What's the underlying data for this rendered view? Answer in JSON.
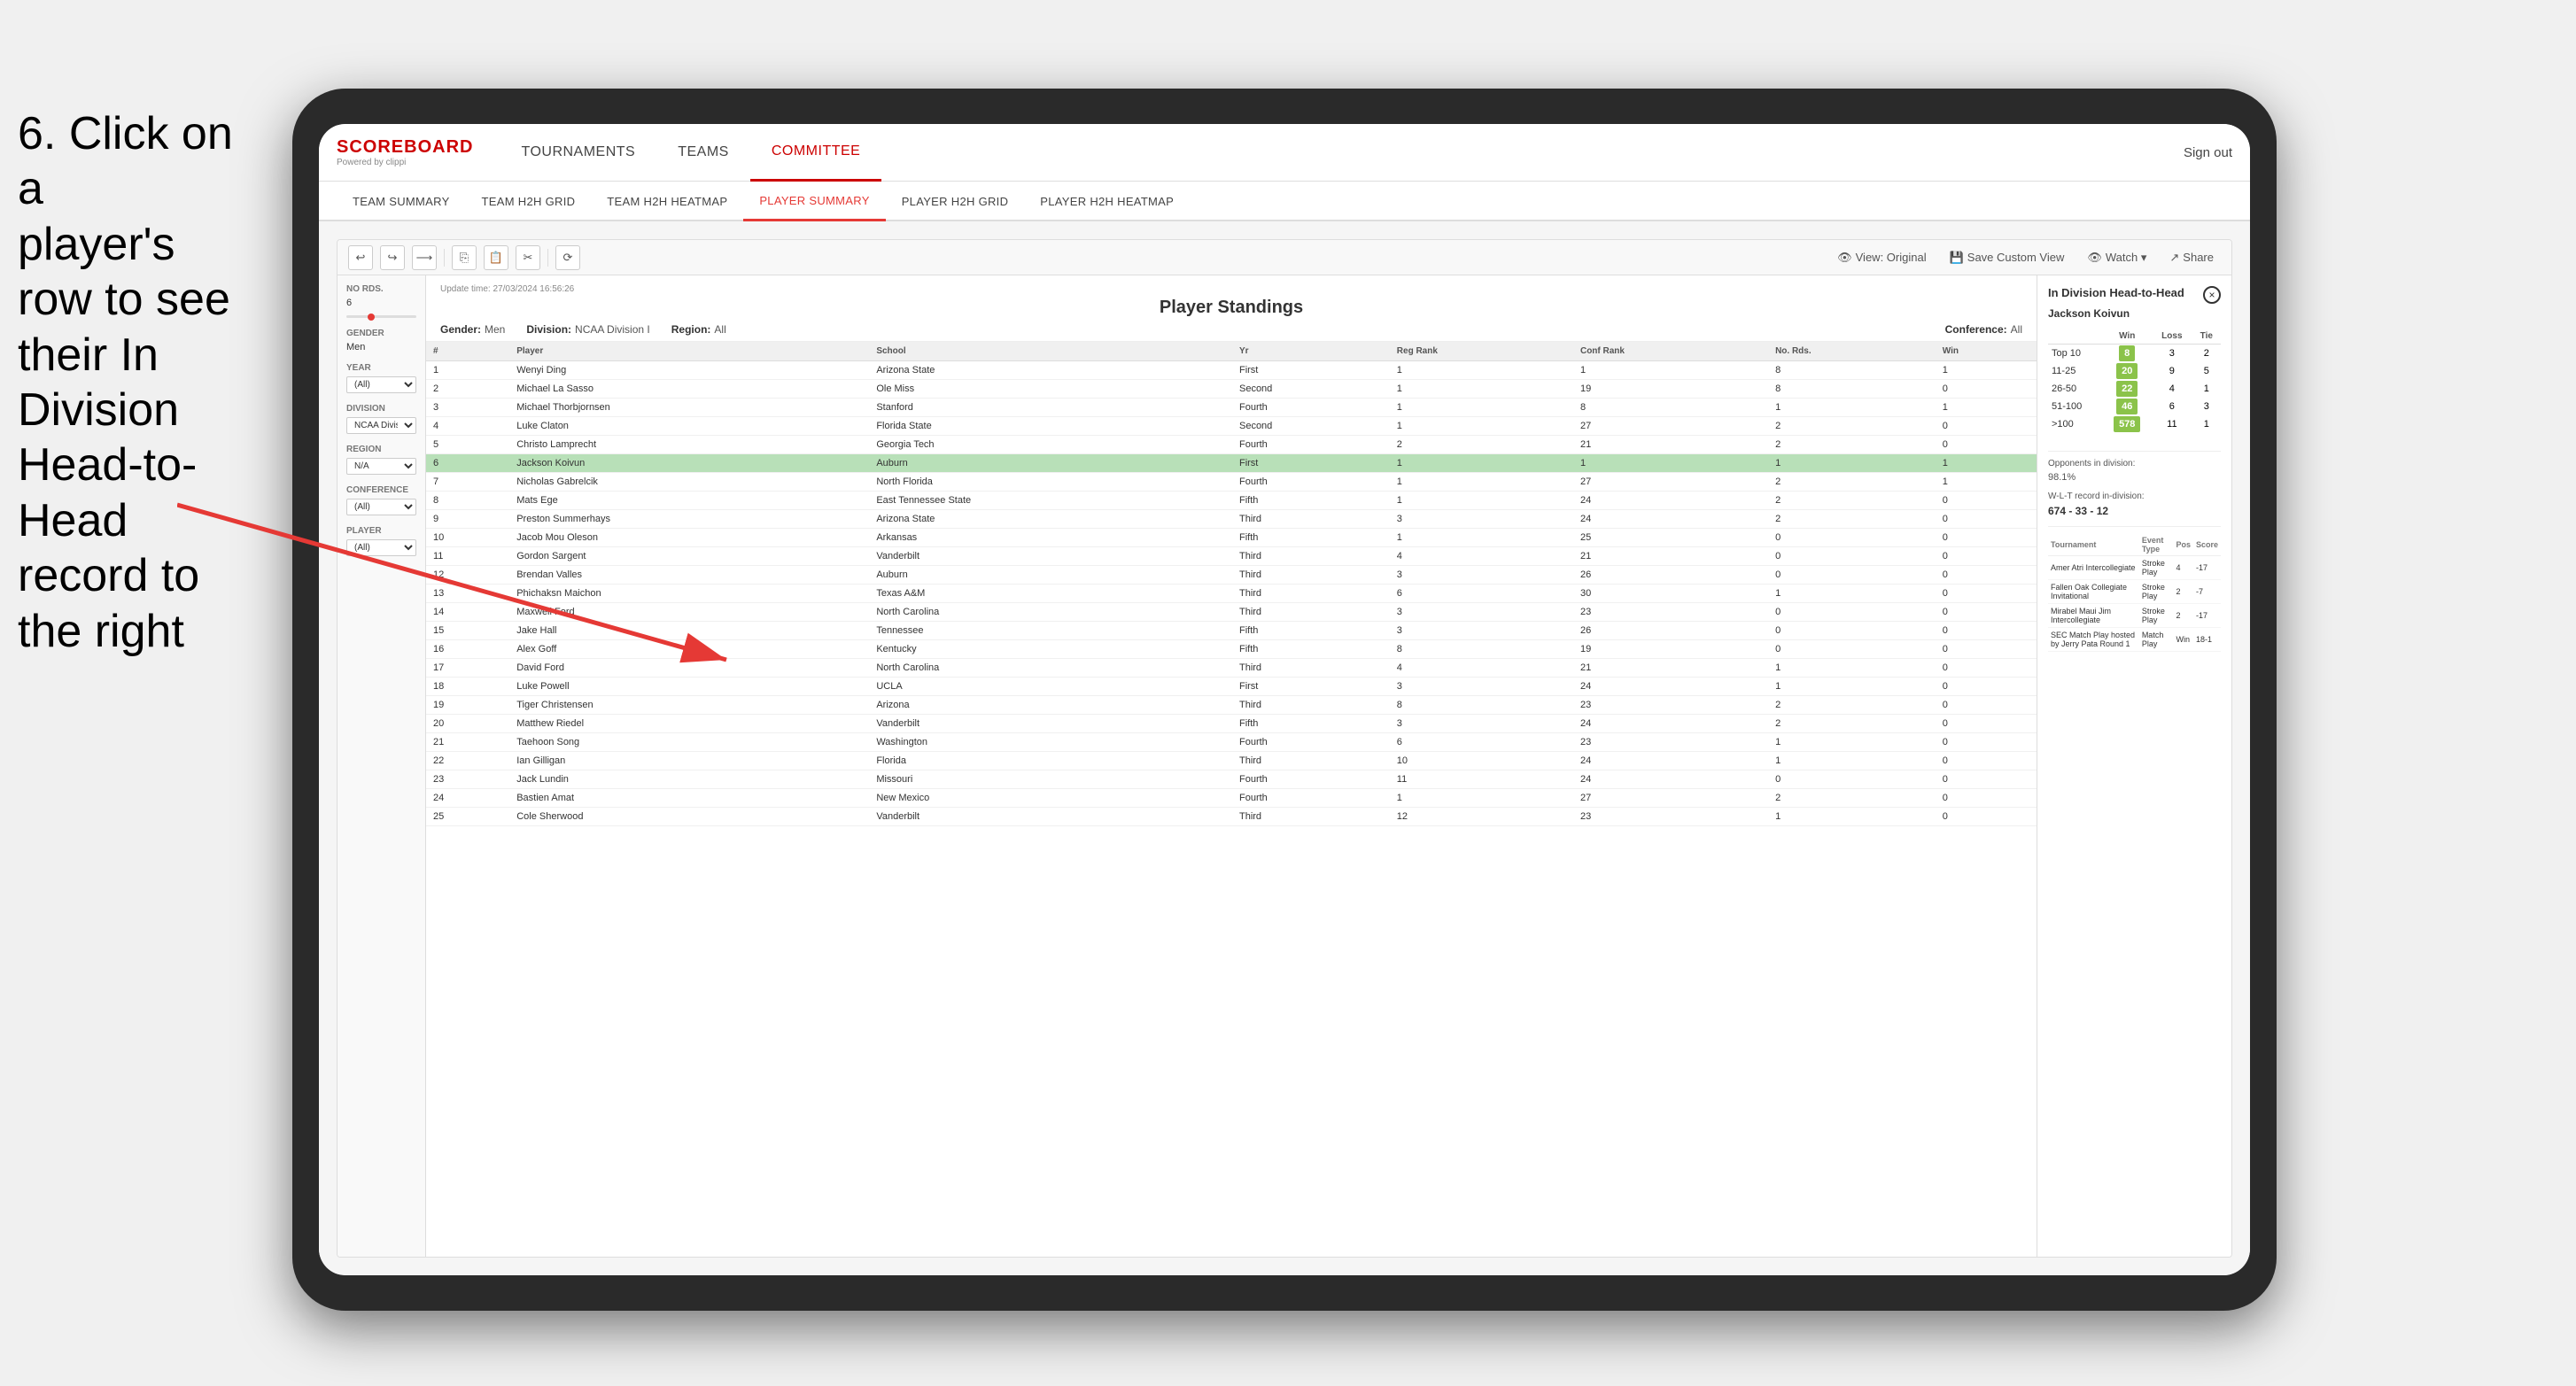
{
  "instruction": {
    "line1": "6. Click on a",
    "line2": "player's row to see",
    "line3": "their In Division",
    "line4": "Head-to-Head",
    "line5": "record to the right"
  },
  "nav": {
    "logo": "SCOREBOARD",
    "logo_sub": "Powered by clippi",
    "items": [
      "TOURNAMENTS",
      "TEAMS",
      "COMMITTEE"
    ],
    "sign_out": "Sign out"
  },
  "sub_nav": {
    "items": [
      "TEAM SUMMARY",
      "TEAM H2H GRID",
      "TEAM H2H HEATMAP",
      "PLAYER SUMMARY",
      "PLAYER H2H GRID",
      "PLAYER H2H HEATMAP"
    ],
    "active": "PLAYER SUMMARY"
  },
  "report": {
    "update_label": "Update time:",
    "update_time": "27/03/2024 16:56:26",
    "title": "Player Standings",
    "filters": {
      "gender_label": "Gender:",
      "gender_val": "Men",
      "division_label": "Division:",
      "division_val": "NCAA Division I",
      "region_label": "Region:",
      "region_val": "All",
      "conference_label": "Conference:",
      "conference_val": "All"
    }
  },
  "filter_sidebar": {
    "no_rds_label": "No Rds.",
    "no_rds_val": "6",
    "gender_label": "Gender",
    "gender_val": "Men",
    "year_label": "Year",
    "year_val": "(All)",
    "division_label": "Division",
    "division_val": "NCAA Division I",
    "region_label": "Region",
    "region_val": "N/A",
    "conference_label": "Conference",
    "conference_val": "(All)",
    "player_label": "Player",
    "player_val": "(All)"
  },
  "table": {
    "headers": [
      "#",
      "Player",
      "School",
      "Yr",
      "Reg Rank",
      "Conf Rank",
      "No. Rds.",
      "Win"
    ],
    "rows": [
      {
        "num": 1,
        "player": "Wenyi Ding",
        "school": "Arizona State",
        "yr": "First",
        "reg_rank": 1,
        "conf_rank": 1,
        "no_rds": 8,
        "win": 1,
        "selected": false
      },
      {
        "num": 2,
        "player": "Michael La Sasso",
        "school": "Ole Miss",
        "yr": "Second",
        "reg_rank": 1,
        "conf_rank": 19,
        "no_rds": 8,
        "win": 0,
        "selected": false
      },
      {
        "num": 3,
        "player": "Michael Thorbjornsen",
        "school": "Stanford",
        "yr": "Fourth",
        "reg_rank": 1,
        "conf_rank": 8,
        "no_rds": 1,
        "win": 1,
        "selected": false
      },
      {
        "num": 4,
        "player": "Luke Claton",
        "school": "Florida State",
        "yr": "Second",
        "reg_rank": 1,
        "conf_rank": 27,
        "no_rds": 2,
        "win": 0,
        "selected": false
      },
      {
        "num": 5,
        "player": "Christo Lamprecht",
        "school": "Georgia Tech",
        "yr": "Fourth",
        "reg_rank": 2,
        "conf_rank": 21,
        "no_rds": 2,
        "win": 0,
        "selected": false
      },
      {
        "num": 6,
        "player": "Jackson Koivun",
        "school": "Auburn",
        "yr": "First",
        "reg_rank": 1,
        "conf_rank": 1,
        "no_rds": 1,
        "win": 1,
        "selected": true
      },
      {
        "num": 7,
        "player": "Nicholas Gabrelcik",
        "school": "North Florida",
        "yr": "Fourth",
        "reg_rank": 1,
        "conf_rank": 27,
        "no_rds": 2,
        "win": 1,
        "selected": false
      },
      {
        "num": 8,
        "player": "Mats Ege",
        "school": "East Tennessee State",
        "yr": "Fifth",
        "reg_rank": 1,
        "conf_rank": 24,
        "no_rds": 2,
        "win": 0,
        "selected": false
      },
      {
        "num": 9,
        "player": "Preston Summerhays",
        "school": "Arizona State",
        "yr": "Third",
        "reg_rank": 3,
        "conf_rank": 24,
        "no_rds": 2,
        "win": 0,
        "selected": false
      },
      {
        "num": 10,
        "player": "Jacob Mou Oleson",
        "school": "Arkansas",
        "yr": "Fifth",
        "reg_rank": 1,
        "conf_rank": 25,
        "no_rds": 0,
        "win": 0,
        "selected": false
      },
      {
        "num": 11,
        "player": "Gordon Sargent",
        "school": "Vanderbilt",
        "yr": "Third",
        "reg_rank": 4,
        "conf_rank": 21,
        "no_rds": 0,
        "win": 0,
        "selected": false
      },
      {
        "num": 12,
        "player": "Brendan Valles",
        "school": "Auburn",
        "yr": "Third",
        "reg_rank": 3,
        "conf_rank": 26,
        "no_rds": 0,
        "win": 0,
        "selected": false
      },
      {
        "num": 13,
        "player": "Phichaksn Maichon",
        "school": "Texas A&M",
        "yr": "Third",
        "reg_rank": 6,
        "conf_rank": 30,
        "no_rds": 1,
        "win": 0,
        "selected": false
      },
      {
        "num": 14,
        "player": "Maxwell Ford",
        "school": "North Carolina",
        "yr": "Third",
        "reg_rank": 3,
        "conf_rank": 23,
        "no_rds": 0,
        "win": 0,
        "selected": false
      },
      {
        "num": 15,
        "player": "Jake Hall",
        "school": "Tennessee",
        "yr": "Fifth",
        "reg_rank": 3,
        "conf_rank": 26,
        "no_rds": 0,
        "win": 0,
        "selected": false
      },
      {
        "num": 16,
        "player": "Alex Goff",
        "school": "Kentucky",
        "yr": "Fifth",
        "reg_rank": 8,
        "conf_rank": 19,
        "no_rds": 0,
        "win": 0,
        "selected": false
      },
      {
        "num": 17,
        "player": "David Ford",
        "school": "North Carolina",
        "yr": "Third",
        "reg_rank": 4,
        "conf_rank": 21,
        "no_rds": 1,
        "win": 0,
        "selected": false
      },
      {
        "num": 18,
        "player": "Luke Powell",
        "school": "UCLA",
        "yr": "First",
        "reg_rank": 3,
        "conf_rank": 24,
        "no_rds": 1,
        "win": 0,
        "selected": false
      },
      {
        "num": 19,
        "player": "Tiger Christensen",
        "school": "Arizona",
        "yr": "Third",
        "reg_rank": 8,
        "conf_rank": 23,
        "no_rds": 2,
        "win": 0,
        "selected": false
      },
      {
        "num": 20,
        "player": "Matthew Riedel",
        "school": "Vanderbilt",
        "yr": "Fifth",
        "reg_rank": 3,
        "conf_rank": 24,
        "no_rds": 2,
        "win": 0,
        "selected": false
      },
      {
        "num": 21,
        "player": "Taehoon Song",
        "school": "Washington",
        "yr": "Fourth",
        "reg_rank": 6,
        "conf_rank": 23,
        "no_rds": 1,
        "win": 0,
        "selected": false
      },
      {
        "num": 22,
        "player": "Ian Gilligan",
        "school": "Florida",
        "yr": "Third",
        "reg_rank": 10,
        "conf_rank": 24,
        "no_rds": 1,
        "win": 0,
        "selected": false
      },
      {
        "num": 23,
        "player": "Jack Lundin",
        "school": "Missouri",
        "yr": "Fourth",
        "reg_rank": 11,
        "conf_rank": 24,
        "no_rds": 0,
        "win": 0,
        "selected": false
      },
      {
        "num": 24,
        "player": "Bastien Amat",
        "school": "New Mexico",
        "yr": "Fourth",
        "reg_rank": 1,
        "conf_rank": 27,
        "no_rds": 2,
        "win": 0,
        "selected": false
      },
      {
        "num": 25,
        "player": "Cole Sherwood",
        "school": "Vanderbilt",
        "yr": "Third",
        "reg_rank": 12,
        "conf_rank": 23,
        "no_rds": 1,
        "win": 0,
        "selected": false
      }
    ]
  },
  "h2h": {
    "title": "In Division Head-to-Head",
    "player": "Jackson Koivun",
    "close_label": "×",
    "table_headers": [
      "",
      "Win",
      "Loss",
      "Tie"
    ],
    "rows": [
      {
        "rank": "Top 10",
        "win": 8,
        "loss": 3,
        "tie": 2
      },
      {
        "rank": "11-25",
        "win": 20,
        "loss": 9,
        "tie": 5
      },
      {
        "rank": "26-50",
        "win": 22,
        "loss": 4,
        "tie": 1
      },
      {
        "rank": "51-100",
        "win": 46,
        "loss": 6,
        "tie": 3
      },
      {
        "rank": ">100",
        "win": 578,
        "loss": 11,
        "tie": 1
      }
    ],
    "opponents_label": "Opponents in division:",
    "wlt_label": "W-L-T record in-division:",
    "pct": "98.1%",
    "record": "674 - 33 - 12",
    "tournaments": {
      "headers": [
        "Tournament",
        "Event Type",
        "Pos",
        "Score"
      ],
      "rows": [
        {
          "tournament": "Amer Atri Intercollegiate",
          "type": "Stroke Play",
          "pos": 4,
          "score": "-17"
        },
        {
          "tournament": "Fallen Oak Collegiate Invitational",
          "type": "Stroke Play",
          "pos": 2,
          "score": "-7"
        },
        {
          "tournament": "Mirabel Maui Jim Intercollegiate",
          "type": "Stroke Play",
          "pos": 2,
          "score": "-17"
        },
        {
          "tournament": "SEC Match Play hosted by Jerry Pata Round 1",
          "type": "Match Play",
          "pos": "Win",
          "score": "18-1"
        }
      ]
    }
  },
  "toolbar": {
    "view_original": "View: Original",
    "save_custom": "Save Custom View",
    "watch": "Watch ▾",
    "share": "Share"
  }
}
